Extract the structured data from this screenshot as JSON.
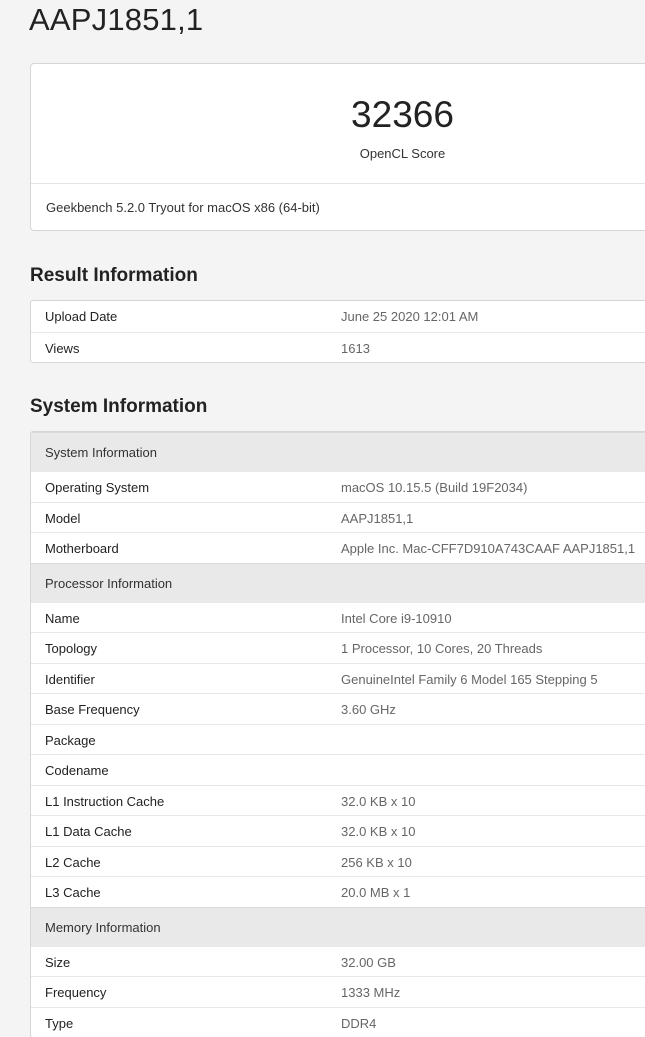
{
  "device": {
    "title": "AAPJ1851,1"
  },
  "score": {
    "value": "32366",
    "label": "OpenCL Score",
    "footer": "Geekbench 5.2.0 Tryout for macOS x86 (64-bit)"
  },
  "result_info": {
    "heading": "Result Information",
    "rows": [
      {
        "key": "Upload Date",
        "value": "June 25 2020 12:01 AM"
      },
      {
        "key": "Views",
        "value": "1613"
      }
    ]
  },
  "system_info": {
    "heading": "System Information",
    "groups": [
      {
        "title": "System Information",
        "rows": [
          {
            "key": "Operating System",
            "value": "macOS 10.15.5 (Build 19F2034)"
          },
          {
            "key": "Model",
            "value": "AAPJ1851,1"
          },
          {
            "key": "Motherboard",
            "value": "Apple Inc. Mac-CFF7D910A743CAAF AAPJ1851,1"
          }
        ]
      },
      {
        "title": "Processor Information",
        "rows": [
          {
            "key": "Name",
            "value": "Intel Core i9-10910"
          },
          {
            "key": "Topology",
            "value": "1 Processor, 10 Cores, 20 Threads"
          },
          {
            "key": "Identifier",
            "value": "GenuineIntel Family 6 Model 165 Stepping 5"
          },
          {
            "key": "Base Frequency",
            "value": "3.60 GHz"
          },
          {
            "key": "Package",
            "value": ""
          },
          {
            "key": "Codename",
            "value": ""
          },
          {
            "key": "L1 Instruction Cache",
            "value": "32.0 KB x 10"
          },
          {
            "key": "L1 Data Cache",
            "value": "32.0 KB x 10"
          },
          {
            "key": "L2 Cache",
            "value": "256 KB x 10"
          },
          {
            "key": "L3 Cache",
            "value": "20.0 MB x 1"
          }
        ]
      },
      {
        "title": "Memory Information",
        "rows": [
          {
            "key": "Size",
            "value": "32.00 GB"
          },
          {
            "key": "Frequency",
            "value": "1333 MHz"
          },
          {
            "key": "Type",
            "value": "DDR4"
          }
        ]
      }
    ]
  }
}
